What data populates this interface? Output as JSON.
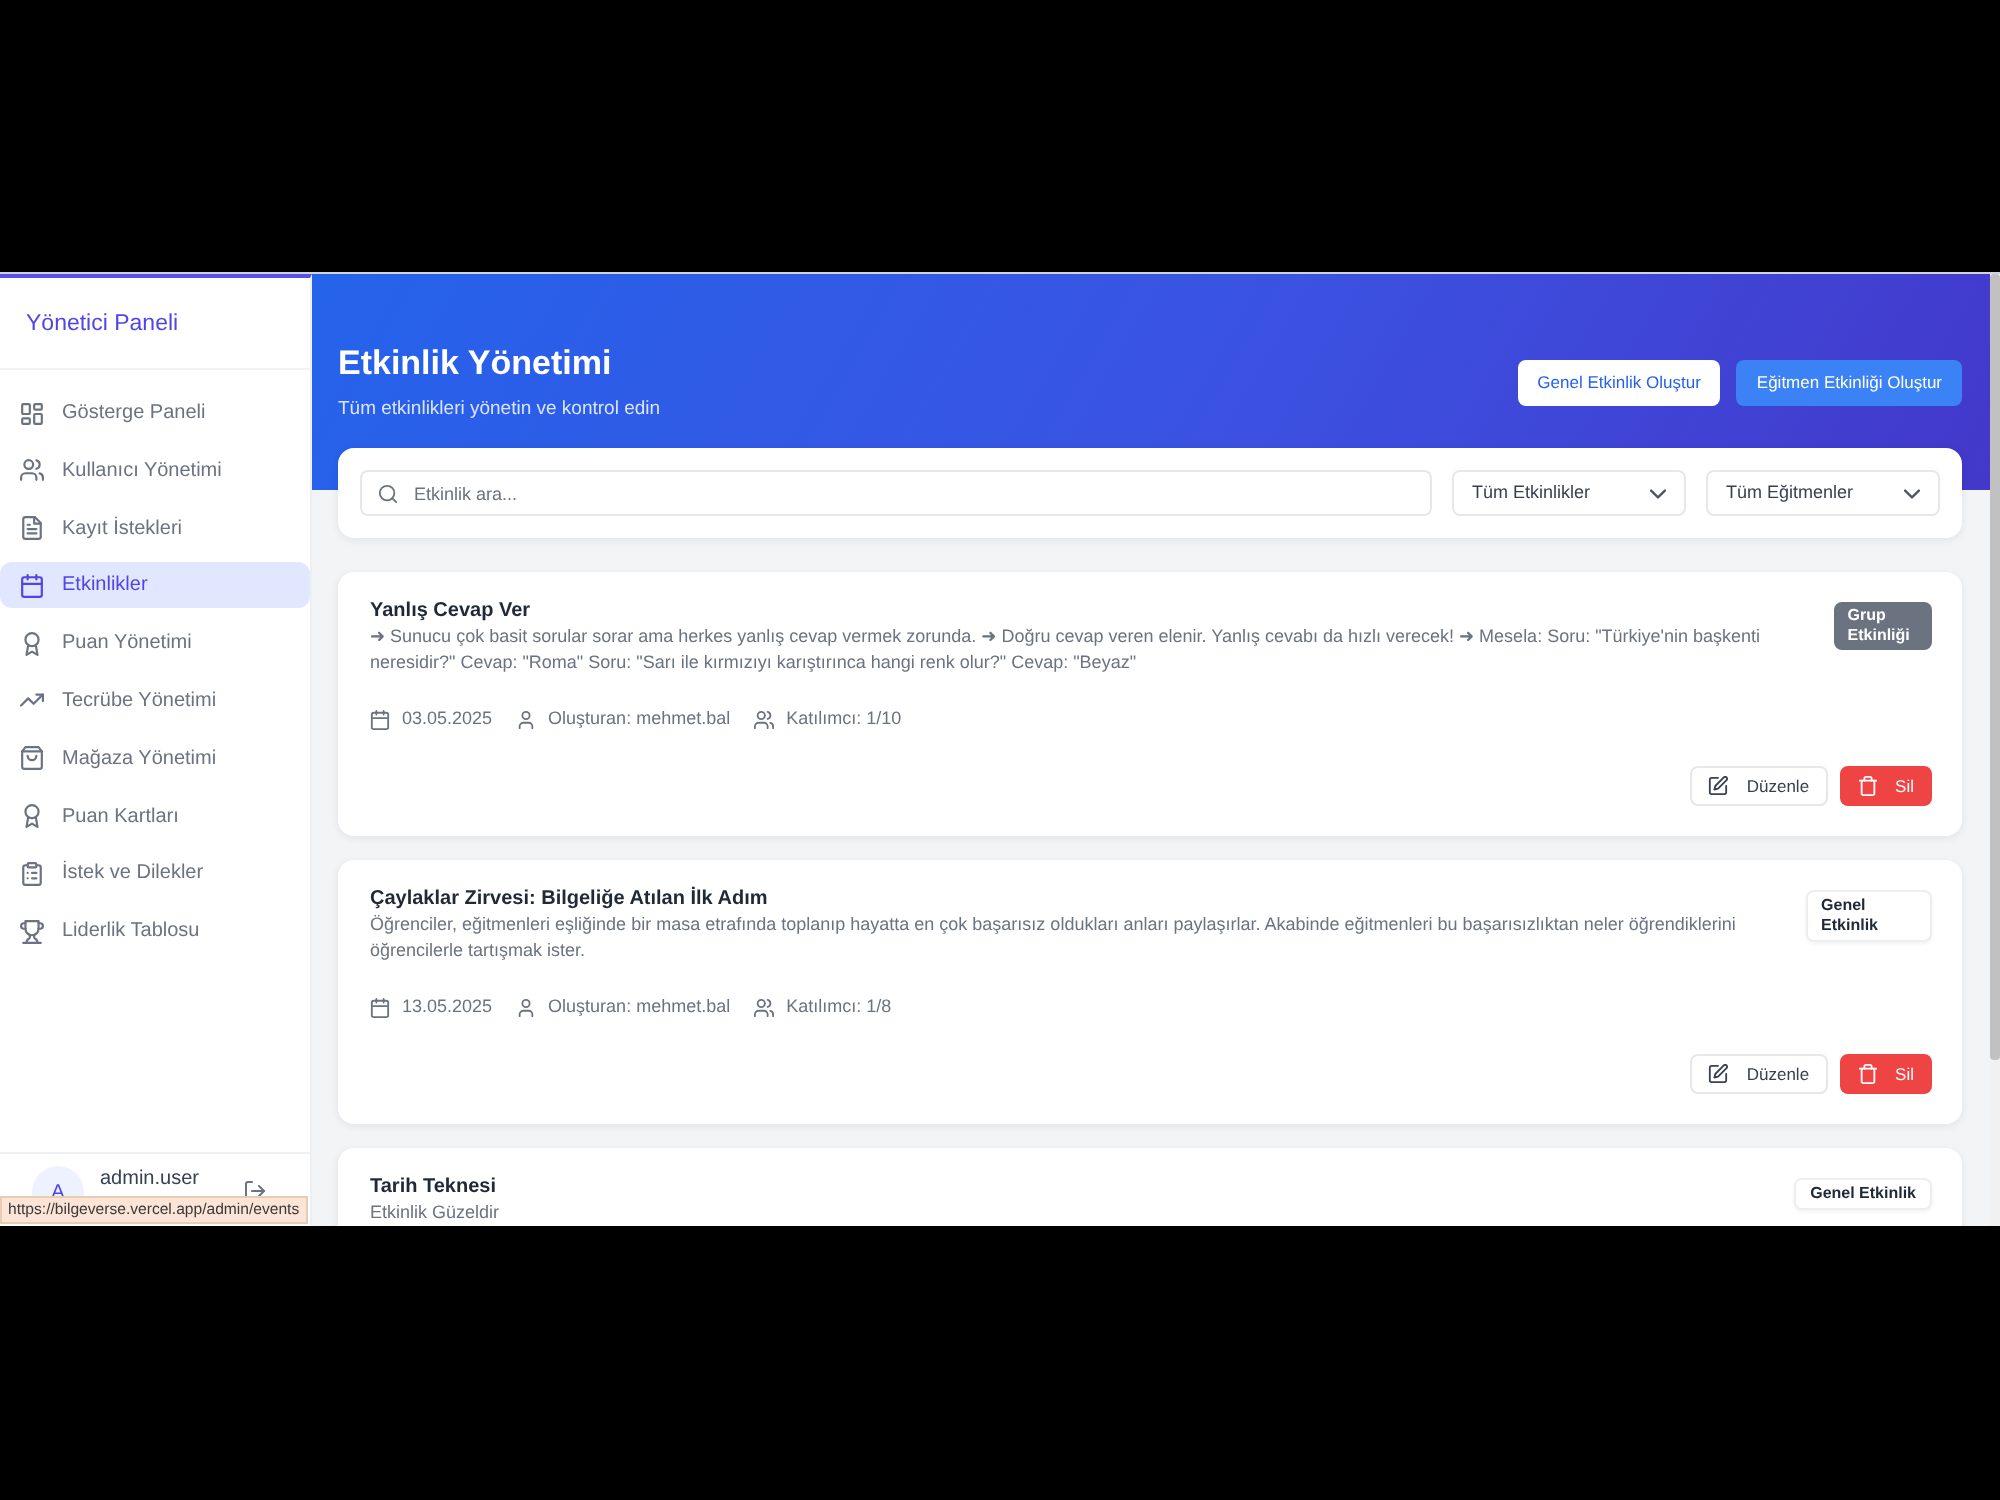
{
  "sidebar": {
    "title": "Yönetici Paneli",
    "items": [
      {
        "label": "Gösterge Paneli",
        "selected": false
      },
      {
        "label": "Kullanıcı Yönetimi",
        "selected": false
      },
      {
        "label": "Kayıt İstekleri",
        "selected": false
      },
      {
        "label": "Etkinlikler",
        "selected": true
      },
      {
        "label": "Puan Yönetimi",
        "selected": false
      },
      {
        "label": "Tecrübe Yönetimi",
        "selected": false
      },
      {
        "label": "Mağaza Yönetimi",
        "selected": false
      },
      {
        "label": "Puan Kartları",
        "selected": false
      },
      {
        "label": "İstek ve Dilekler",
        "selected": false
      },
      {
        "label": "Liderlik Tablosu",
        "selected": false
      }
    ],
    "user": {
      "avatar": "A",
      "name": "admin.user"
    }
  },
  "header": {
    "title": "Etkinlik Yönetimi",
    "subtitle": "Tüm etkinlikleri yönetin ve kontrol edin",
    "buttons": [
      {
        "label": "Genel Etkinlik Oluştur",
        "kind": "light"
      },
      {
        "label": "Eğitmen Etkinliği Oluştur",
        "kind": "primary"
      }
    ]
  },
  "filters": {
    "search": {
      "placeholder": "Etkinlik ara..."
    },
    "selects": [
      {
        "value": "Tüm Etkinlikler"
      },
      {
        "value": "Tüm Eğitmenler"
      }
    ]
  },
  "events": [
    {
      "title": "Yanlış Cevap Ver",
      "description": "➜ Sunucu çok basit sorular sorar ama herkes yanlış cevap vermek zorunda. ➜ Doğru cevap veren elenir. Yanlış cevabı da hızlı verecek! ➜ Mesela: Soru: \"Türkiye'nin başkenti neresidir?\" Cevap: \"Roma\" Soru: \"Sarı ile kırmızıyı karıştırınca hangi renk olur?\" Cevap: \"Beyaz\"",
      "badge": {
        "label": "Grup Etkinliği",
        "kind": "group"
      },
      "date": "03.05.2025",
      "creator": "Oluşturan: mehmet.bal",
      "participants": "Katılımcı: 1/10",
      "actions": [
        {
          "label": "Düzenle",
          "kind": "edit"
        },
        {
          "label": "Sil",
          "kind": "delete"
        }
      ]
    },
    {
      "title": "Çaylaklar Zirvesi: Bilgeliğe Atılan İlk Adım",
      "description": "Öğrenciler, eğitmenleri eşliğinde bir masa etrafında toplanıp hayatta en çok başarısız oldukları anları paylaşırlar. Akabinde eğitmenleri bu başarısızlıktan neler öğrendiklerini öğrencilerle tartışmak ister.",
      "badge": {
        "label": "Genel Etkinlik",
        "kind": "general"
      },
      "date": "13.05.2025",
      "creator": "Oluşturan: mehmet.bal",
      "participants": "Katılımcı: 1/8",
      "actions": [
        {
          "label": "Düzenle",
          "kind": "edit"
        },
        {
          "label": "Sil",
          "kind": "delete"
        }
      ]
    },
    {
      "title": "Tarih Teknesi",
      "description": "Etkinlik Güzeldir",
      "badge": {
        "label": "Genel Etkinlik",
        "kind": "general"
      }
    }
  ],
  "status_url": "https://bilgeverse.vercel.app/admin/events"
}
